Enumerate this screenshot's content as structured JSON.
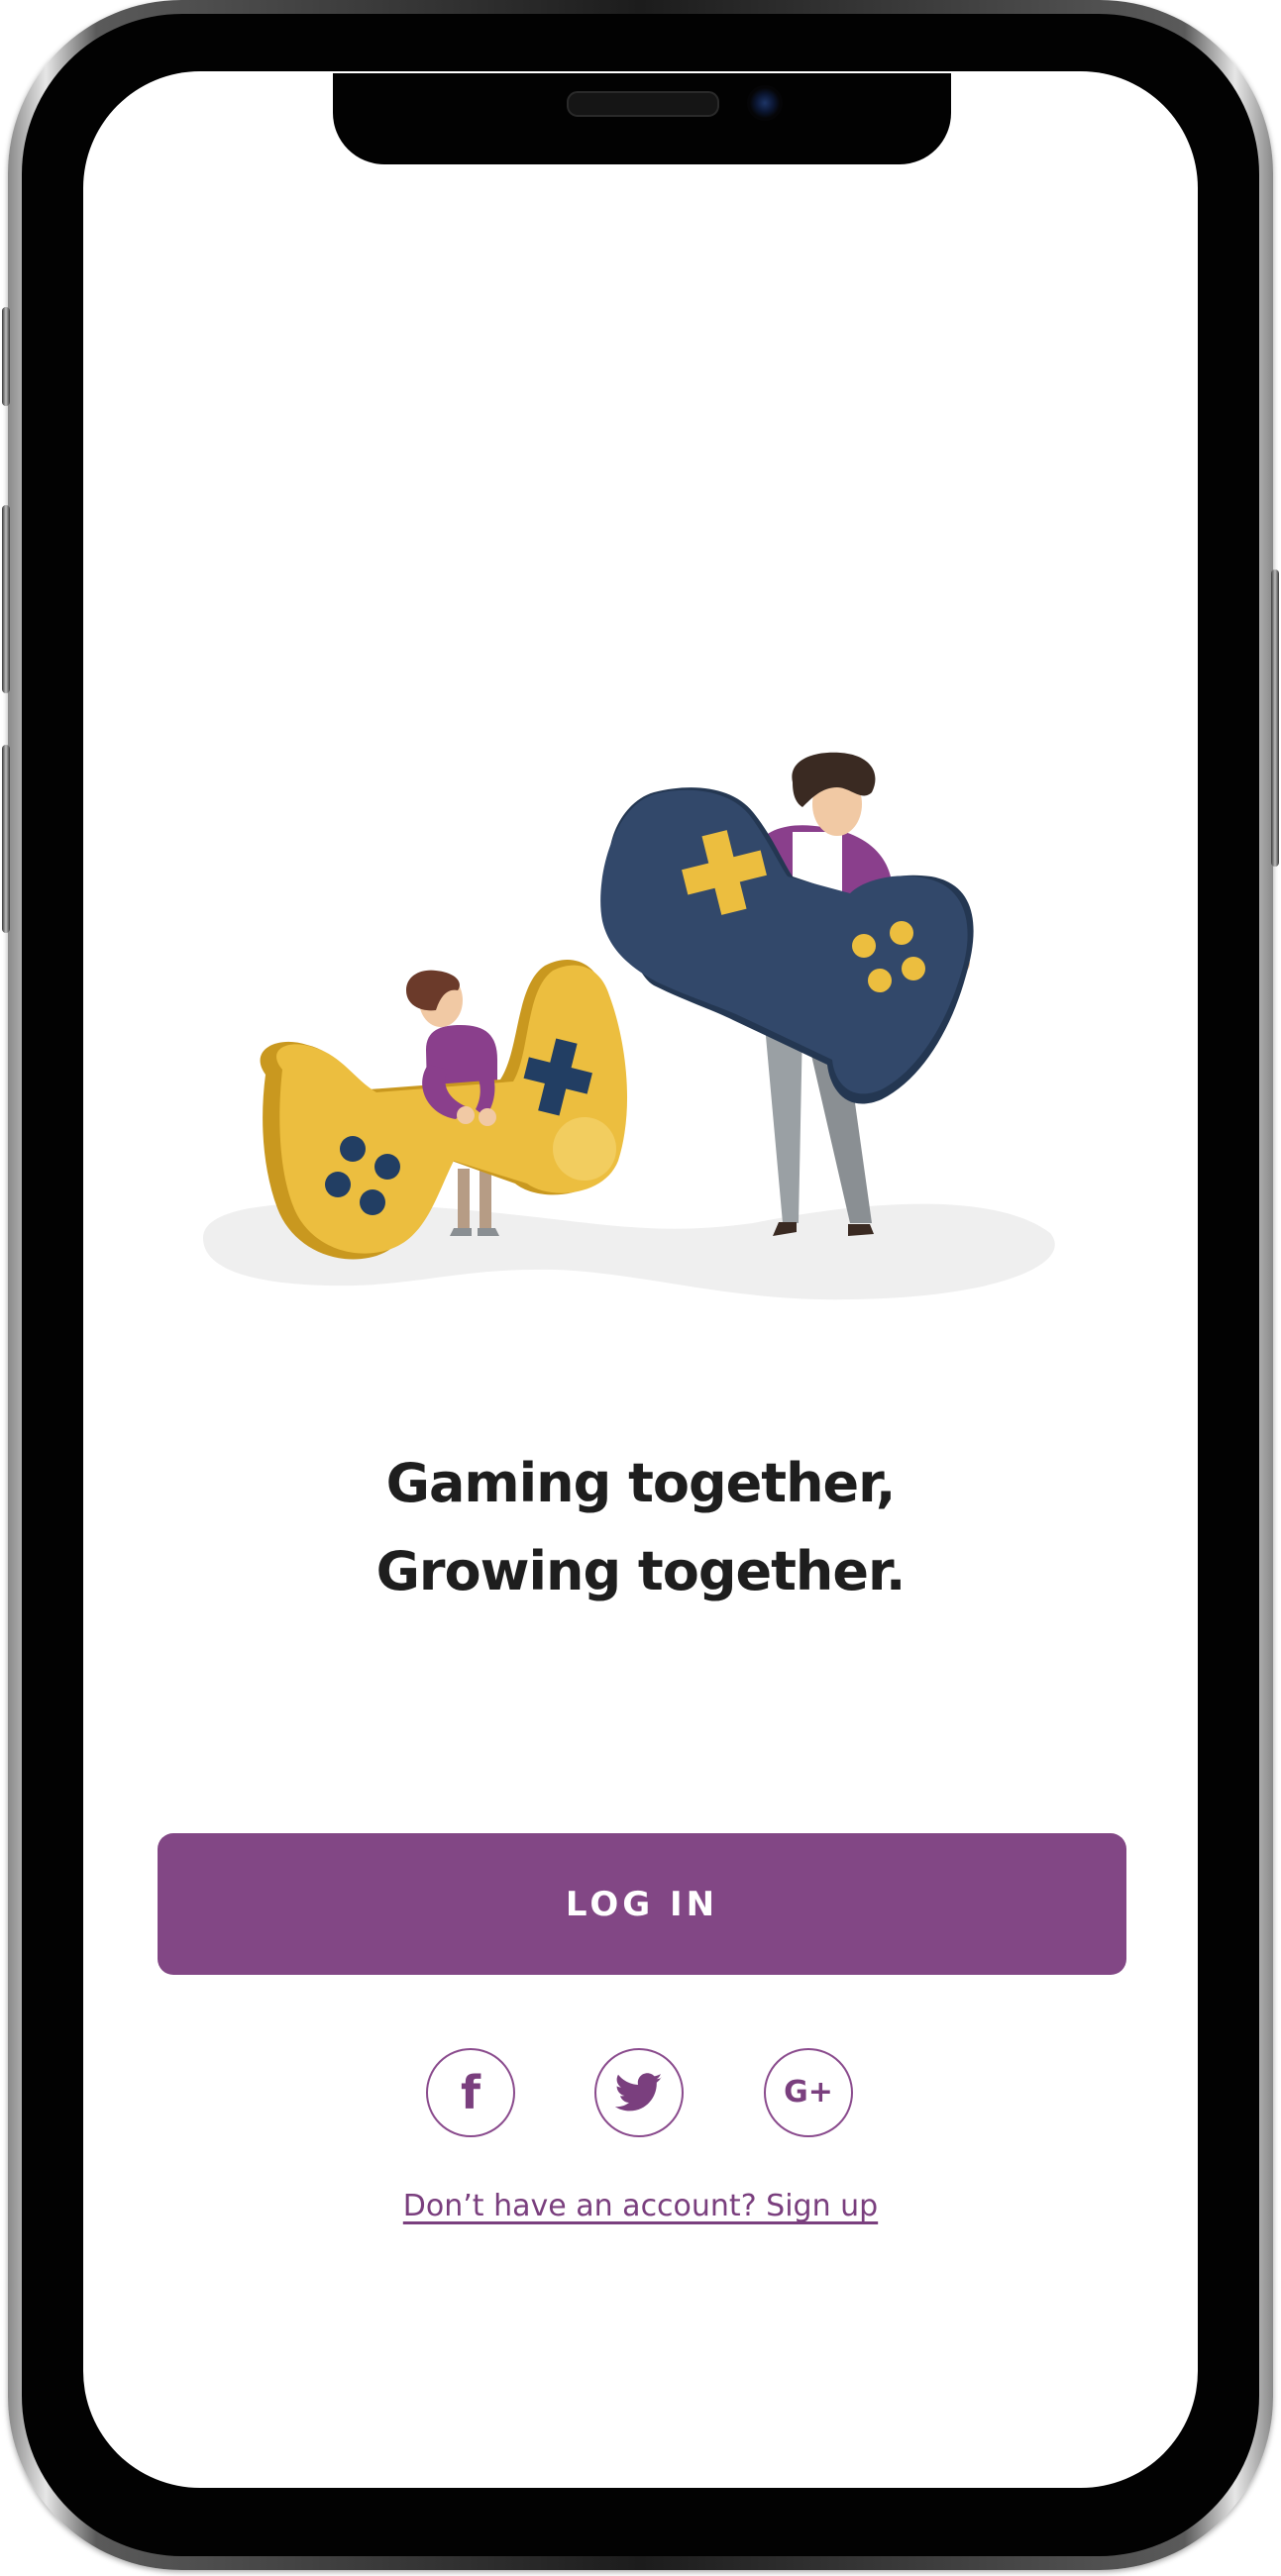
{
  "tagline": {
    "line1": "Gaming together,",
    "line2": "Growing together."
  },
  "login_button": {
    "label": "LOG IN"
  },
  "social": [
    {
      "icon": "facebook-icon",
      "glyph": "f"
    },
    {
      "icon": "twitter-icon"
    },
    {
      "icon": "google-plus-icon",
      "glyph": "G+"
    }
  ],
  "signup_link": {
    "label": "Don’t have an account? Sign up"
  },
  "colors": {
    "accent": "#824785",
    "accent_outline": "#8a4b8d",
    "text": "#1e1e1e",
    "controller_yellow": "#ecbe3f",
    "controller_navy": "#2f4462"
  }
}
